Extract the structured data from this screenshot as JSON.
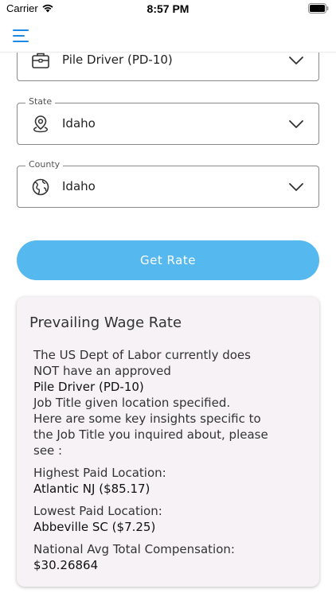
{
  "status_bar": {
    "carrier": "Carrier",
    "time": "8:57 PM"
  },
  "header": {
    "menu_icon": "hamburger-menu-icon",
    "accent_color": "#1e88e5"
  },
  "form": {
    "job_title": {
      "value": "Pile Driver (PD-10)",
      "icon": "briefcase-icon"
    },
    "state": {
      "label": "State",
      "value": "Idaho",
      "icon": "location-pin-icon"
    },
    "county": {
      "label": "County",
      "value": "Idaho",
      "icon": "globe-icon"
    },
    "get_rate_label": "Get Rate",
    "button_color": "#55b8ef"
  },
  "result": {
    "title": "Prevailing Wage Rate",
    "line1": "The US Dept of Labor currently does",
    "line2": "NOT have an approved",
    "job_title": "Pile Driver (PD-10)",
    "line3": "Job Title given location specified.",
    "line4": "Here are some  key insights specific to",
    "line5": "the Job Title you inquired about, please",
    "line6": "see :",
    "highest_label": "Highest Paid Location:",
    "highest_value": "Atlantic NJ ($85.17)",
    "lowest_label": "Lowest Paid Location:",
    "lowest_value": "Abbeville SC ($7.25)",
    "national_label": "National Avg Total Compensation:",
    "national_value": "$30.26864"
  }
}
